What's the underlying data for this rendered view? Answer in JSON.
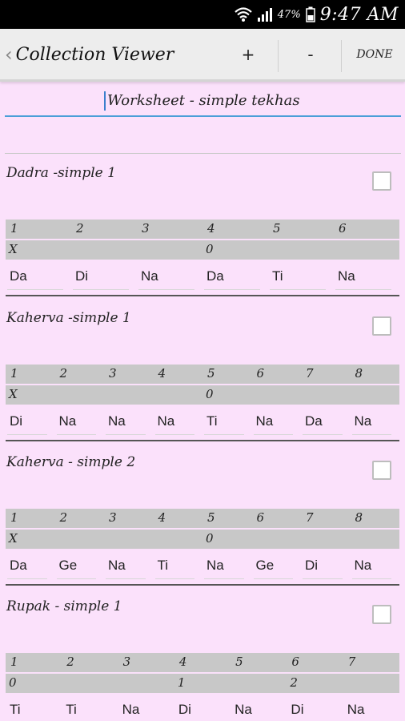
{
  "status": {
    "battery": "47%",
    "time": "9:47 AM"
  },
  "actionbar": {
    "title": "Collection Viewer",
    "add_label": "+",
    "remove_label": "-",
    "done_label": "DONE"
  },
  "collection_name": "Worksheet - simple tekhas",
  "items": [
    {
      "title": "Dadra -simple 1",
      "beats": [
        "1",
        "2",
        "3",
        "4",
        "5",
        "6"
      ],
      "marks": [
        "X",
        "",
        "",
        "0",
        "",
        ""
      ],
      "bols": [
        "Da",
        "Di",
        "Na",
        "Da",
        "Ti",
        "Na"
      ]
    },
    {
      "title": "Kaherva -simple 1",
      "beats": [
        "1",
        "2",
        "3",
        "4",
        "5",
        "6",
        "7",
        "8"
      ],
      "marks": [
        "X",
        "",
        "",
        "",
        "0",
        "",
        "",
        ""
      ],
      "bols": [
        "Di",
        "Na",
        "Na",
        "Na",
        "Ti",
        "Na",
        "Da",
        "Na"
      ]
    },
    {
      "title": "Kaherva - simple 2",
      "beats": [
        "1",
        "2",
        "3",
        "4",
        "5",
        "6",
        "7",
        "8"
      ],
      "marks": [
        "X",
        "",
        "",
        "",
        "0",
        "",
        "",
        ""
      ],
      "bols": [
        "Da",
        "Ge",
        "Na",
        "Ti",
        "Na",
        "Ge",
        "Di",
        "Na"
      ]
    },
    {
      "title": "Rupak - simple 1",
      "beats": [
        "1",
        "2",
        "3",
        "4",
        "5",
        "6",
        "7"
      ],
      "marks": [
        "0",
        "",
        "",
        "1",
        "",
        "2",
        ""
      ],
      "bols": [
        "Ti",
        "Ti",
        "Na",
        "Di",
        "Na",
        "Di",
        "Na"
      ]
    }
  ]
}
